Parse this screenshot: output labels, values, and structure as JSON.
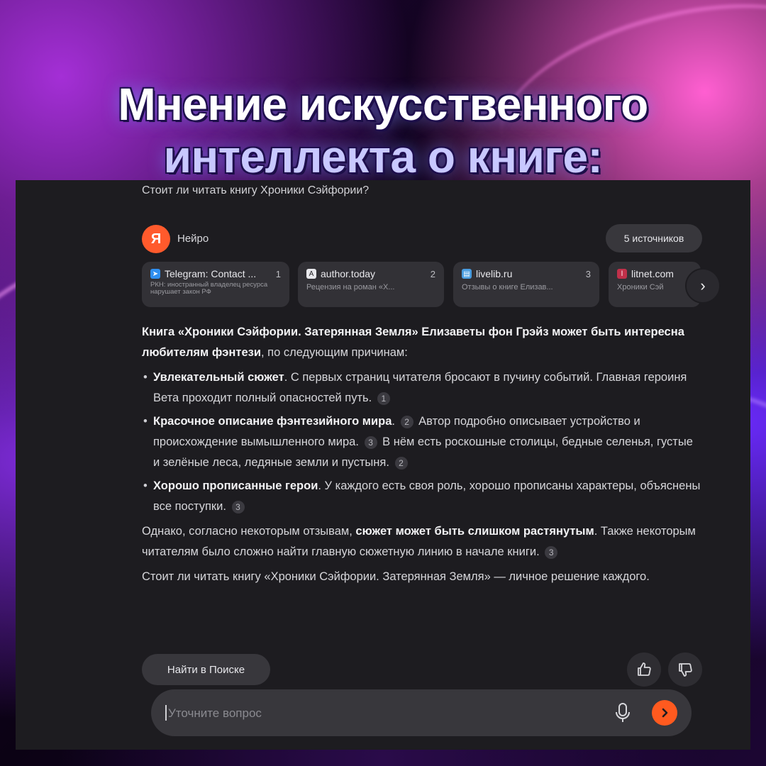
{
  "header": {
    "title_line1": "Мнение искусственного",
    "title_line2": "интеллекта о книге:"
  },
  "chat": {
    "question": "Стоит ли читать книгу Хроники Сэйфории?",
    "assistant_name": "Нейро",
    "assistant_avatar_text": "Я",
    "sources_button": "5 источников",
    "sources": [
      {
        "site": "Telegram: Contact ...",
        "num": "1",
        "snippet": "РКН: иностранный владелец ресурса нарушает закон РФ",
        "icon": "telegram-icon",
        "color": "#2f8ff0"
      },
      {
        "site": "author.today",
        "num": "2",
        "snippet": "Рецензия на роман «Х...",
        "icon": "author-today-icon",
        "color": "#e8e8ec"
      },
      {
        "site": "livelib.ru",
        "num": "3",
        "snippet": "Отзывы о книге Елизав...",
        "icon": "livelib-icon",
        "color": "#4a9de0"
      },
      {
        "site": "litnet.com",
        "num": "",
        "snippet": "Хроники Сэй",
        "icon": "litnet-icon",
        "color": "#c0304a"
      }
    ],
    "answer": {
      "intro_bold": "Книга «Хроники Сэйфории. Затерянная Земля» Елизаветы фон Грэйз может быть интересна любителям фэнтези",
      "intro_rest": ", по следующим причинам:",
      "bullets": [
        {
          "bold": "Увлекательный сюжет",
          "text": ". С первых страниц читателя бросают в пучину событий. Главная героиня Вета проходит полный опасностей путь.",
          "ref": "1"
        },
        {
          "bold": "Красочное описание фэнтезийного мира",
          "ref_a": "2",
          "text_a": "Автор подробно описывает устройство и происхождение вымышленного мира.",
          "ref_b": "3",
          "text_b": "В нём есть роскошные столицы, бедные селенья, густые и зелёные леса, ледяные земли и пустыня.",
          "ref_c": "2"
        },
        {
          "bold": "Хорошо прописанные герои",
          "text": ". У каждого есть своя роль, хорошо прописаны характеры, объяснены все поступки.",
          "ref": "3"
        }
      ],
      "however_start": "Однако, согласно некоторым отзывам, ",
      "however_bold": "сюжет может быть слишком растянутым",
      "however_end": ". Также некоторым читателям было сложно найти главную сюжетную линию в начале книги.",
      "however_ref": "3",
      "conclusion": "Стоит ли читать книгу «Хроники Сэйфории. Затерянная Земля» — личное решение каждого."
    },
    "search_button": "Найти в Поиске",
    "input_placeholder": "Уточните вопрос",
    "accent_color": "#ff5a1f"
  }
}
